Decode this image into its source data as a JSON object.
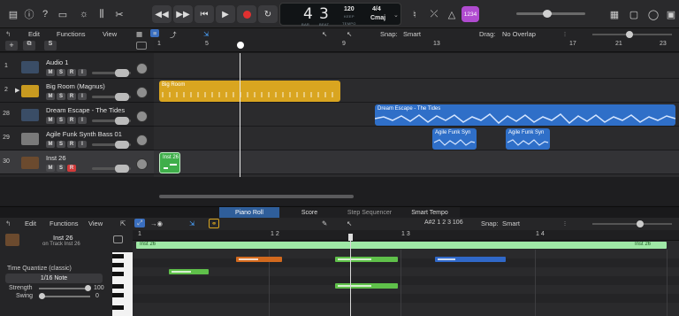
{
  "control_bar": {
    "tempo": "120",
    "tempo_caption": "KEEP",
    "time_signature": "4/4",
    "key": "Cmaj",
    "bar": "4",
    "beat": "3",
    "bar_caption": "BAR",
    "beat_caption": "BEAT",
    "tempo_label": "TEMPO",
    "count_in": "1234",
    "colors": {
      "record": "#e03030",
      "accent": "#4aa3ff",
      "count_in_bg": "#b04bd0"
    }
  },
  "tracks_toolbar": {
    "edit": "Edit",
    "functions": "Functions",
    "view": "View",
    "snap_label": "Snap:",
    "snap_value": "Smart",
    "drag_label": "Drag:",
    "drag_value": "No Overlap"
  },
  "track_list_header": {
    "add": "+",
    "s_button": "S"
  },
  "ruler_bars": [
    "1",
    "5",
    "9",
    "13",
    "17",
    "21",
    "23"
  ],
  "tracks": [
    {
      "num": "1",
      "name": "Audio 1",
      "m": "M",
      "s": "S",
      "r": "R",
      "i": "I"
    },
    {
      "num": "2",
      "name": "Big Room (Magnus)",
      "m": "M",
      "s": "S",
      "r": "R",
      "i": "I"
    },
    {
      "num": "28",
      "name": "Dream Escape - The Tides",
      "m": "M",
      "s": "S",
      "r": "R",
      "i": "I"
    },
    {
      "num": "29",
      "name": "Agile Funk Synth Bass 01",
      "m": "M",
      "s": "S",
      "r": "R",
      "i": "I"
    },
    {
      "num": "30",
      "name": "Inst 26",
      "m": "M",
      "s": "S",
      "r": "R"
    }
  ],
  "regions": {
    "big_room": "Big Room",
    "dream_escape": "Dream Escape - The Tides",
    "agile_1": "Agile Funk Syn",
    "agile_2": "Agile Funk Syn",
    "inst26": "Inst 26"
  },
  "piano_roll": {
    "tabs": [
      "Piano Roll",
      "Score",
      "Step Sequencer",
      "Smart Tempo"
    ],
    "edit": "Edit",
    "functions": "Functions",
    "view": "View",
    "pitch_pos": "A#2  1 2 3 106",
    "snap_label": "Snap:",
    "snap_value": "Smart",
    "region_name": "Inst 26",
    "region_sub": "on Track Inst 26",
    "time_quantize_label": "Time Quantize (classic)",
    "quantize_value": "1/16 Note",
    "strength_label": "Strength",
    "strength_value": "100",
    "swing_label": "Swing",
    "swing_value": "0",
    "ruler": [
      "1",
      "1 2",
      "1 3",
      "1 4"
    ],
    "region_bar_left": "Inst 26",
    "region_bar_right": "Inst 26"
  }
}
